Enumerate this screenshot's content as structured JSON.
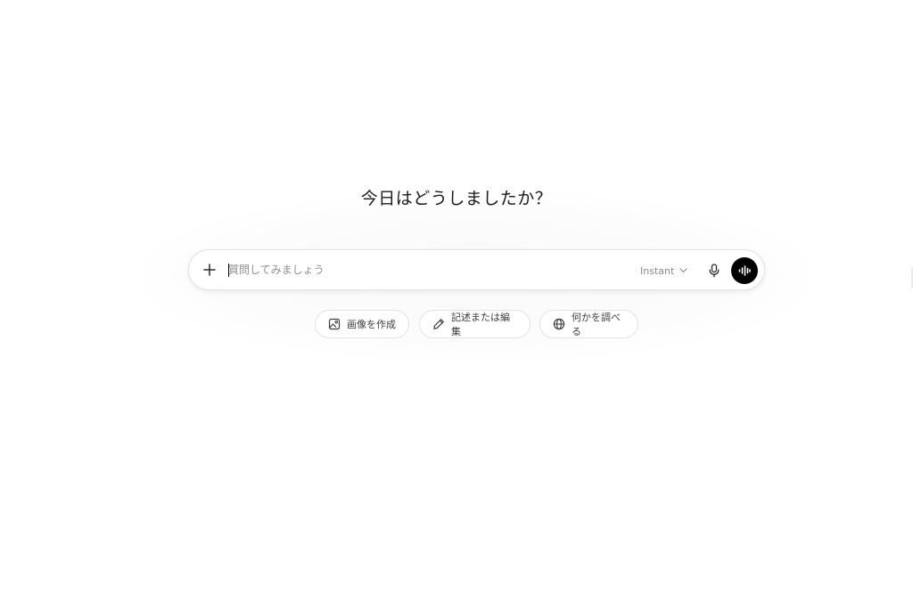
{
  "headline": "今日はどうしましたか？",
  "composer": {
    "placeholder": "質問してみましょう",
    "value": "",
    "model_label": "Instant",
    "icons": {
      "add": "plus-icon",
      "model_dropdown": "chevron-down-icon",
      "dictate": "microphone-icon",
      "voice_mode": "voice-waveform-icon"
    }
  },
  "suggestions": [
    {
      "label": "画像を作成",
      "icon": "image-icon"
    },
    {
      "label": "記述または編集",
      "icon": "pencil-icon"
    },
    {
      "label": "何かを調べる",
      "icon": "globe-icon"
    }
  ],
  "colors": {
    "background": "#ffffff",
    "voice_button": "#000000",
    "placeholder": "#8f8f8f",
    "border": "#e3e3e3"
  }
}
